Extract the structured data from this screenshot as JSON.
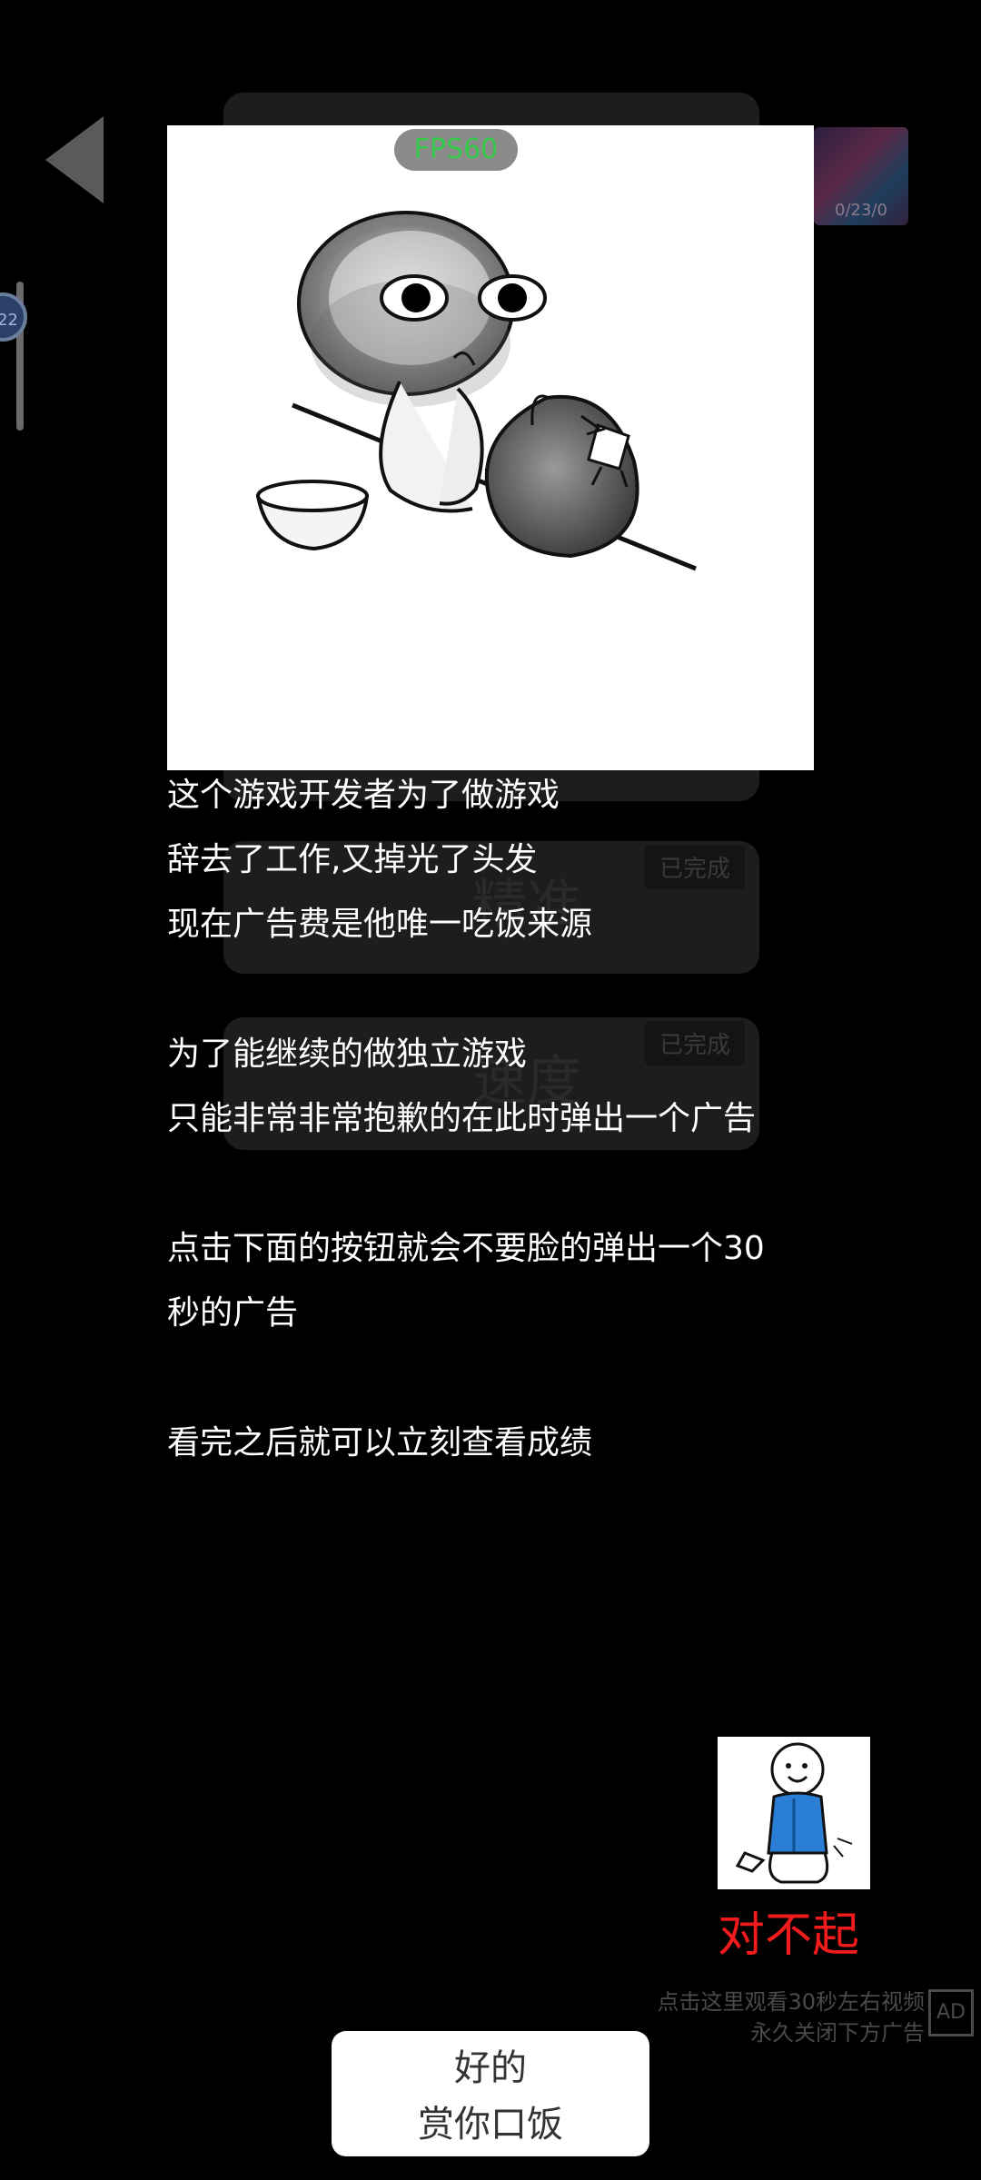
{
  "overlay": {
    "fps_label": "FPS60",
    "message_lines": [
      "这个游戏开发者为了做游戏",
      "辞去了工作,又掉光了头发",
      "现在广告费是他唯一吃饭来源",
      "为了能继续的做独立游戏",
      "只能非常非常抱歉的在此时弹出一个广告",
      "点击下面的按钮就会不要脸的弹出一个30",
      "秒的广告",
      "看完之后就可以立刻查看成绩"
    ],
    "sorry_text": "对不起",
    "ad_note_line1": "点击这里观看30秒左右视频",
    "ad_note_line2": "永久关闭下方广告",
    "ad_icon_label": "AD",
    "ok_button_line1": "好的",
    "ok_button_line2": "赏你口饭"
  },
  "background": {
    "badge_1": "已完成",
    "badge_2": "已完成",
    "card_2_word": "精准",
    "card_3_word": "速度",
    "thumb_label": "0/23/0",
    "slider_value": "22"
  },
  "colors": {
    "background": "#000000",
    "fps_text": "#36c94a",
    "sorry_text": "#f21b1b",
    "button": "#ffffff"
  }
}
